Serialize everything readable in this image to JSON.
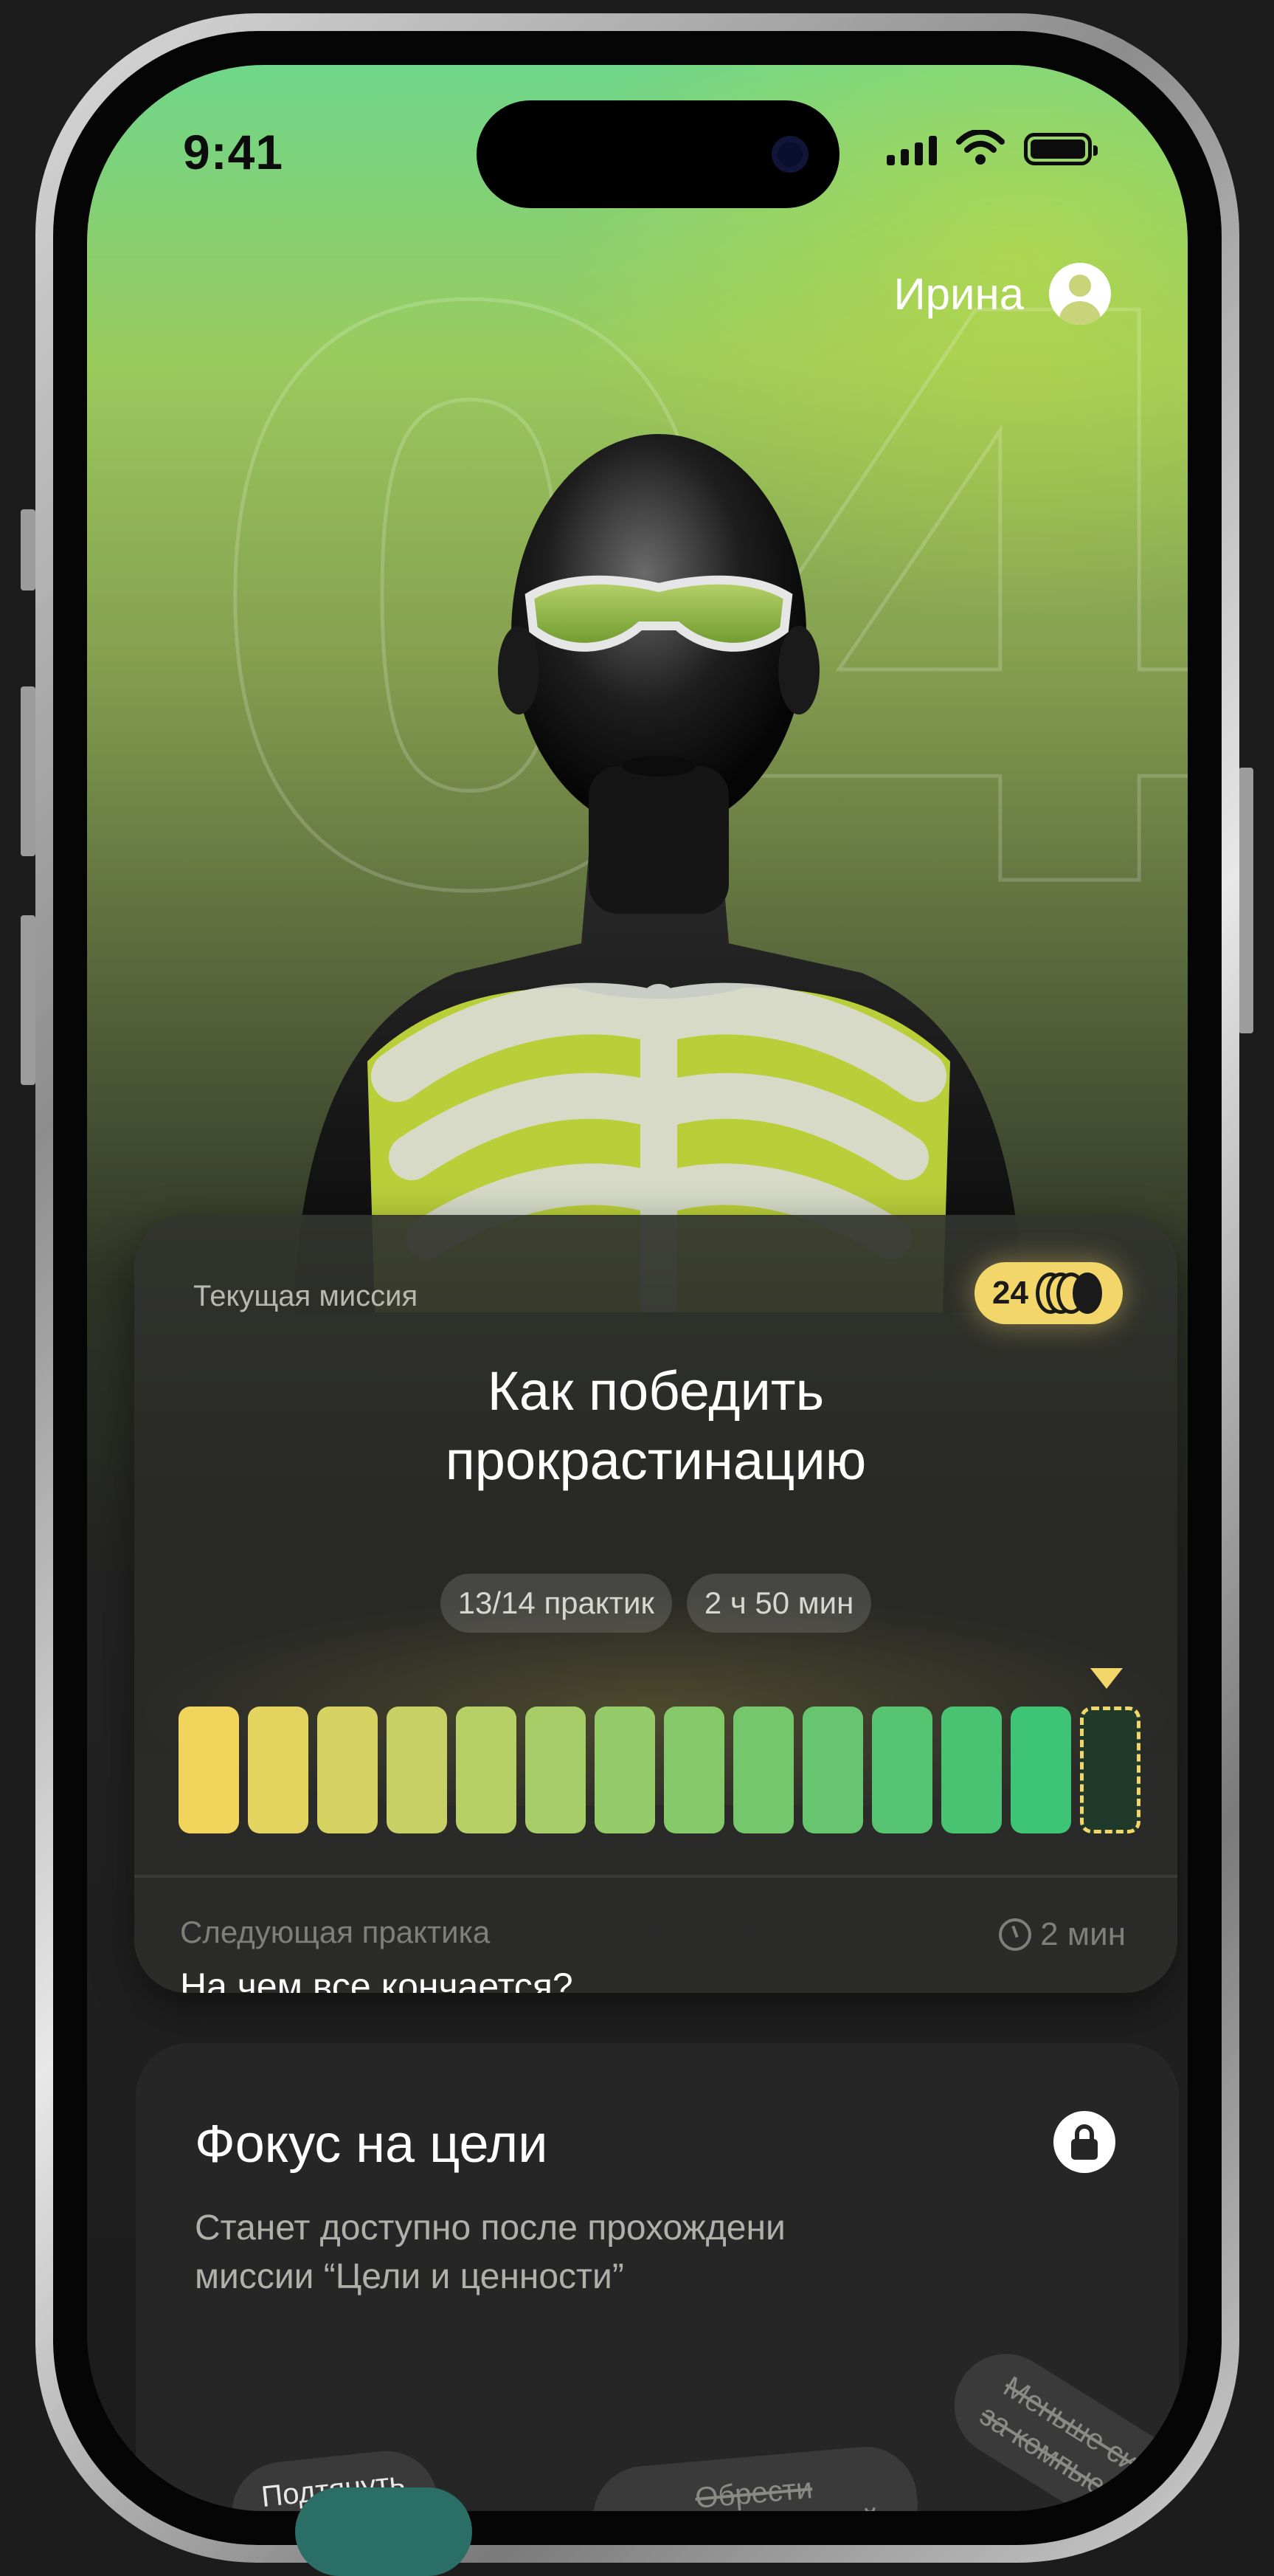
{
  "status_bar": {
    "time": "9:41",
    "battery_level": 1.0,
    "signal_bars": 4
  },
  "user": {
    "name": "Ирина",
    "avatar_icon": "user-icon"
  },
  "hero": {
    "number": "04"
  },
  "mission_card": {
    "label": "Текущая миссия",
    "coins": "24",
    "title": "Как победить\nпрокрастинацию",
    "pills": [
      "13/14 практик",
      "2 ч 50 мин"
    ],
    "progress": {
      "completed": 13,
      "total": 14
    },
    "segment_colors": [
      "#f0d45c",
      "#e3d35f",
      "#d5d262",
      "#c6d064",
      "#b6cf66",
      "#a6cd68",
      "#96cb69",
      "#86c96a",
      "#76c76c",
      "#66c56e",
      "#56c470",
      "#48c372",
      "#3dc474"
    ],
    "next_label": "Следующая практика",
    "next_title": "На чем все кончается?",
    "next_time": "2 мин"
  },
  "focus_card": {
    "title": "Фокус на цели",
    "description": "Станет доступно после прохождени\nмиссии “Цели и ценности”",
    "chips": [
      "Подтянуть\nсвое тело",
      "Обрести\nвнутренний покой",
      "Меньше сидеть\nза компьютером"
    ]
  }
}
